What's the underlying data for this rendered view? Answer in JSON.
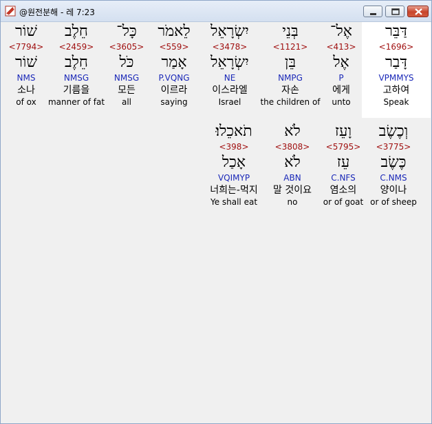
{
  "window": {
    "title": "@원전분해 - 레 7:23"
  },
  "row1": [
    {
      "hebrew": "דַּבֵּר",
      "strong": "<1696>",
      "lemma": "דָּבַר",
      "morph": "VPMMYS",
      "korean": "고하여",
      "english": "Speak"
    },
    {
      "hebrew": "אֶל־",
      "strong": "<413>",
      "lemma": "אֶל",
      "morph": "P",
      "korean": "에게",
      "english": "unto"
    },
    {
      "hebrew": "בְּנֵי",
      "strong": "<1121>",
      "lemma": "בֵּן",
      "morph": "NMPG",
      "korean": "자손",
      "english": "the children of"
    },
    {
      "hebrew": "יִשְׂרָאֵל",
      "strong": "<3478>",
      "lemma": "יִשְׂרָאֵל",
      "morph": "NE",
      "korean": "이스라엘",
      "english": "Israel"
    },
    {
      "hebrew": "לֵאמֹר",
      "strong": "<559>",
      "lemma": "אָמַר",
      "morph": "P.VQNG",
      "korean": "이르라",
      "english": "saying"
    },
    {
      "hebrew": "כָּל־",
      "strong": "<3605>",
      "lemma": "כֹּל",
      "morph": "NMSG",
      "korean": "모든",
      "english": "all"
    },
    {
      "hebrew": "חֵלֶב",
      "strong": "<2459>",
      "lemma": "חֵלֶב",
      "morph": "NMSG",
      "korean": "기름을",
      "english": "manner of fat"
    },
    {
      "hebrew": "שׁוֹר",
      "strong": "<7794>",
      "lemma": "שׁוֹר",
      "morph": "NMS",
      "korean": "소나",
      "english": "of ox"
    }
  ],
  "row2": [
    {
      "hebrew": "וְכֶשֶׂב",
      "strong": "<3775>",
      "lemma": "כֶּשֶׂב",
      "morph": "C.NMS",
      "korean": "양이나",
      "english": "or of sheep"
    },
    {
      "hebrew": "וָעֵז",
      "strong": "<5795>",
      "lemma": "עֵז",
      "morph": "C.NFS",
      "korean": "염소의",
      "english": "or of goat"
    },
    {
      "hebrew": "לֹא",
      "strong": "<3808>",
      "lemma": "לֹא",
      "morph": "ABN",
      "korean": "말 것이요",
      "english": "no"
    },
    {
      "hebrew": "תֹאכֵלוּ׃",
      "strong": "<398>",
      "lemma": "אָכַל",
      "morph": "VQIMYP",
      "korean": "너희는-먹지",
      "english": "Ye shall eat"
    }
  ]
}
